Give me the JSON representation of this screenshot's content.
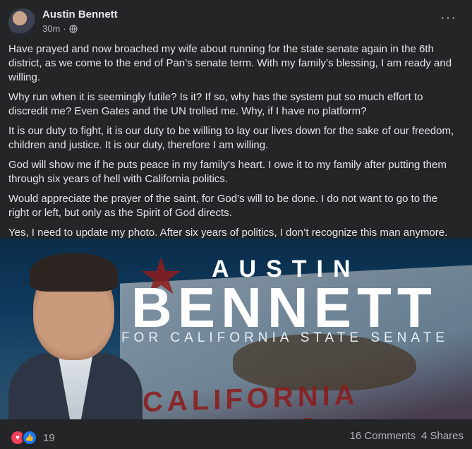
{
  "post": {
    "author": "Austin Bennett",
    "time": "30m",
    "separator": "·",
    "paragraphs": [
      "Have prayed and now broached my wife about running for the state senate again in the 6th district, as we come to the end of Pan’s senate term. With my family’s blessing, I am ready and willing.",
      "Why run when it is seemingly futile? Is it? If so, why has the system put so much effort to discredit me? Even Gates and the UN trolled me. Why, if I have no platform?",
      "It is our duty to fight, it is our duty to be willing to lay our lives down for the sake of our freedom, children and justice. It is our duty, therefore I am willing.",
      "God will show me if he puts peace in my family’s heart. I owe it to my family after putting them through six years of hell with California politics.",
      "Would appreciate the prayer of the saint, for God’s will to be done. I do not want to go to the right or left, but only as the Spirit of God directs.",
      "Yes, I need to update my photo. After six years of politics, I don’t recognize this man anymore."
    ],
    "banner": {
      "first_name": "AUSTIN",
      "last_name": "BENNETT",
      "subtitle": "FOR CALIFORNIA STATE SENATE",
      "flag_text": "CALIFORNIA REPUBLIC"
    },
    "reactions": {
      "count": "19",
      "icons": [
        "love-icon",
        "like-icon"
      ]
    },
    "stats": {
      "comments": "16 Comments",
      "shares": "4 Shares"
    }
  },
  "colors": {
    "background": "#242526",
    "text": "#e4e6eb",
    "secondary": "#b0b3b8",
    "love": "#f33e58",
    "like": "#1877f2"
  }
}
